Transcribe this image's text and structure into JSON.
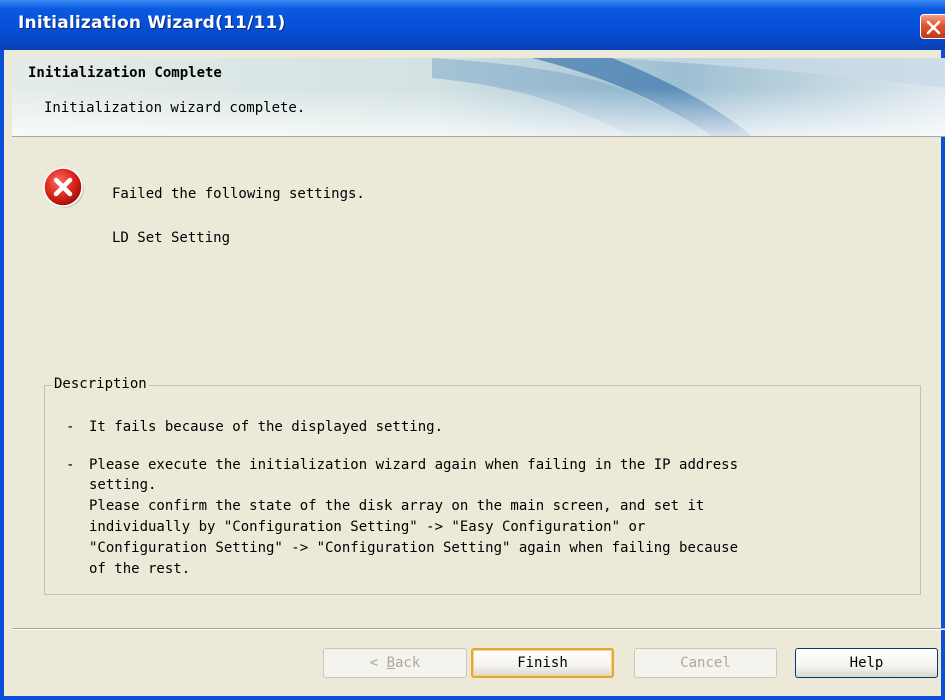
{
  "window": {
    "title": "Initialization Wizard(11/11)"
  },
  "banner": {
    "title": "Initialization Complete",
    "subtitle": "Initialization wizard complete."
  },
  "result": {
    "icon": "error-icon",
    "message": "Failed the following settings.",
    "failed_item": "LD Set Setting"
  },
  "description": {
    "legend": "Description",
    "items": [
      {
        "dash": "-",
        "lines": [
          "It fails because of the displayed setting."
        ]
      },
      {
        "dash": "-",
        "lines": [
          "Please execute the initialization wizard again when failing in the IP address",
          "setting.",
          "Please confirm the state of the disk array on the main screen, and set it",
          "individually by \"Configuration Setting\" -> \"Easy Configuration\" or",
          "\"Configuration Setting\" -> \"Configuration Setting\" again when failing because",
          "of the rest."
        ]
      }
    ]
  },
  "buttons": {
    "back_prefix": "< ",
    "back_mnemonic": "B",
    "back_rest": "ack",
    "finish": "Finish",
    "cancel": "Cancel",
    "help": "Help"
  },
  "colors": {
    "titlebar": "#0550d8",
    "dialog_bg": "#ece9d8",
    "close_button": "#e0552e",
    "error_icon": "#d8221a"
  }
}
